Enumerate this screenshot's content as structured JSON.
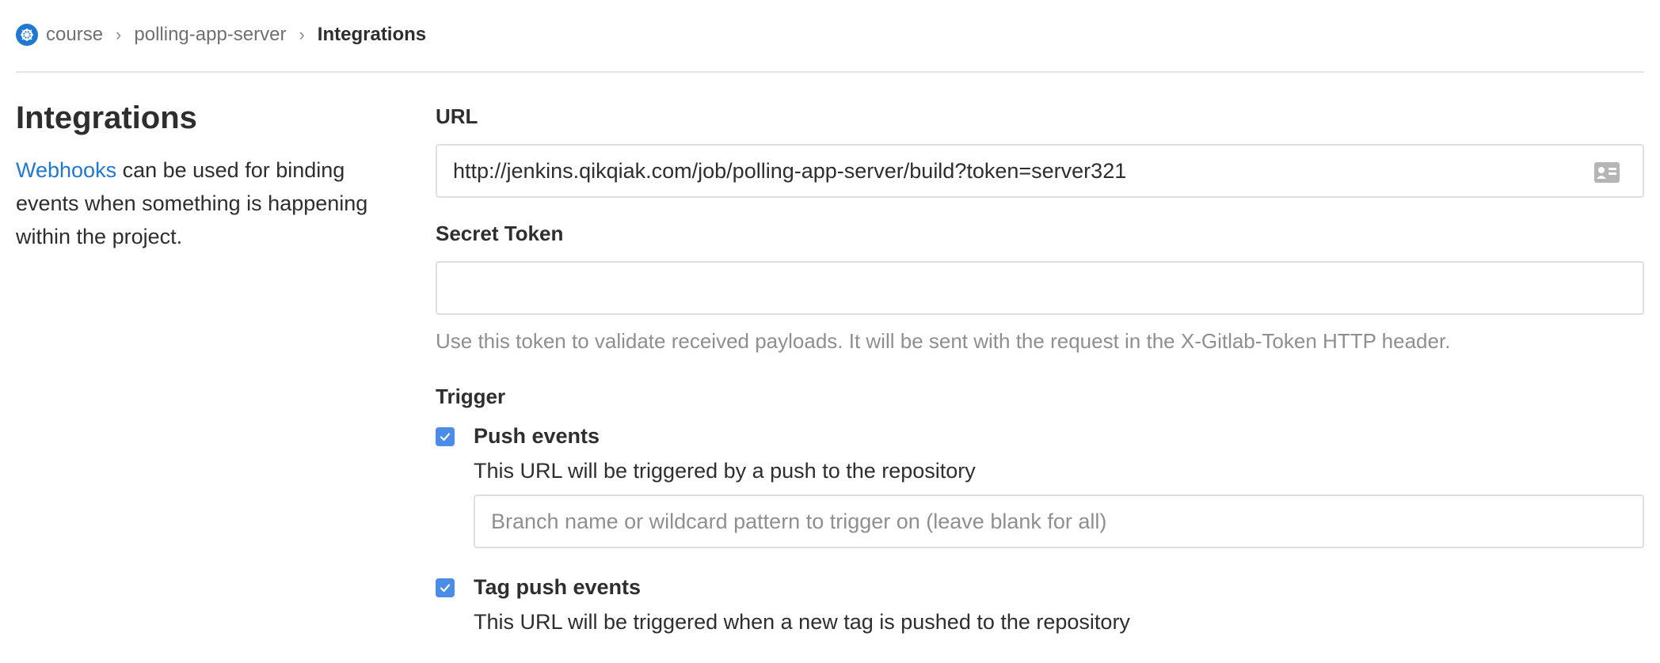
{
  "breadcrumb": {
    "items": [
      "course",
      "polling-app-server"
    ],
    "current": "Integrations",
    "separator": "›"
  },
  "sidebar": {
    "title": "Integrations",
    "description_link": "Webhooks",
    "description_text": " can be used for binding events when something is happening within the project."
  },
  "form": {
    "url_label": "URL",
    "url_value": "http://jenkins.qikqiak.com/job/polling-app-server/build?token=server321",
    "secret_label": "Secret Token",
    "secret_value": "",
    "secret_help": "Use this token to validate received payloads. It will be sent with the request in the X-Gitlab-Token HTTP header.",
    "trigger_label": "Trigger",
    "triggers": [
      {
        "title": "Push events",
        "checked": true,
        "description": "This URL will be triggered by a push to the repository",
        "branch_placeholder": "Branch name or wildcard pattern to trigger on (leave blank for all)"
      },
      {
        "title": "Tag push events",
        "checked": true,
        "description": "This URL will be triggered when a new tag is pushed to the repository"
      }
    ]
  },
  "colors": {
    "link": "#1f78d1",
    "checkbox": "#4b8ce6",
    "muted": "#8f8f8f"
  },
  "icons": {
    "project": "kubernetes-wheel-icon",
    "url_field": "contact-card-icon",
    "breadcrumb_sep": "chevron-right-icon",
    "checkbox": "checkmark-icon"
  }
}
